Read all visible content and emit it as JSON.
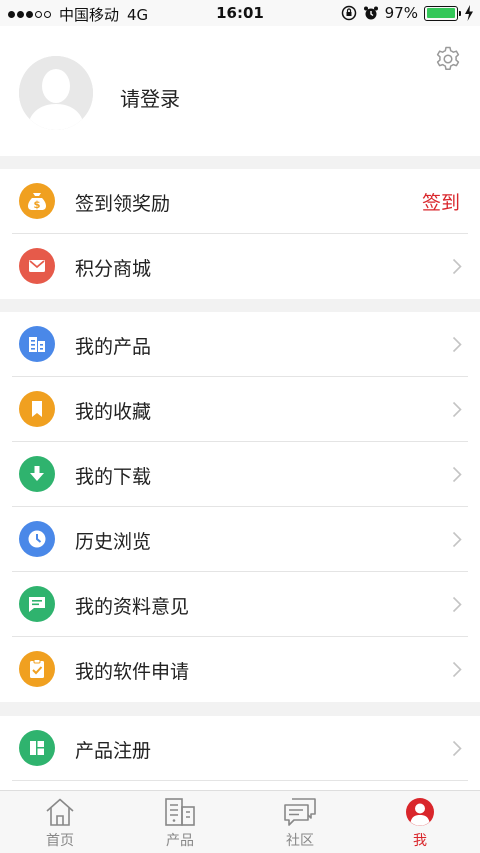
{
  "status_bar": {
    "carrier": "中国移动",
    "network": "4G",
    "time": "16:01",
    "battery_percent": "97%",
    "battery_level": 0.97
  },
  "profile": {
    "login_prompt": "请登录"
  },
  "colors": {
    "accent": "#d9262b",
    "coin": "#f0a020",
    "mall": "#e65a4a",
    "products": "#4a88e8",
    "favorites": "#f0a020",
    "downloads": "#2fb36e",
    "history": "#4a88e8",
    "feedback": "#2fb36e",
    "apply": "#f0a020",
    "register": "#2fb36e"
  },
  "menu": {
    "rewards": {
      "checkin": {
        "label": "签到领奖励",
        "action": "签到",
        "icon": "money-bag-icon"
      },
      "mall": {
        "label": "积分商城",
        "icon": "mail-icon"
      }
    },
    "mine": {
      "products": {
        "label": "我的产品",
        "icon": "building-icon"
      },
      "favorites": {
        "label": "我的收藏",
        "icon": "bookmark-icon"
      },
      "downloads": {
        "label": "我的下载",
        "icon": "download-icon"
      },
      "history": {
        "label": "历史浏览",
        "icon": "clock-icon"
      },
      "feedback": {
        "label": "我的资料意见",
        "icon": "chat-icon"
      },
      "apply": {
        "label": "我的软件申请",
        "icon": "clipboard-check-icon"
      }
    },
    "register": {
      "label": "产品注册",
      "icon": "layout-icon"
    }
  },
  "tabs": {
    "home": "首页",
    "products": "产品",
    "community": "社区",
    "me": "我",
    "active": "me"
  }
}
